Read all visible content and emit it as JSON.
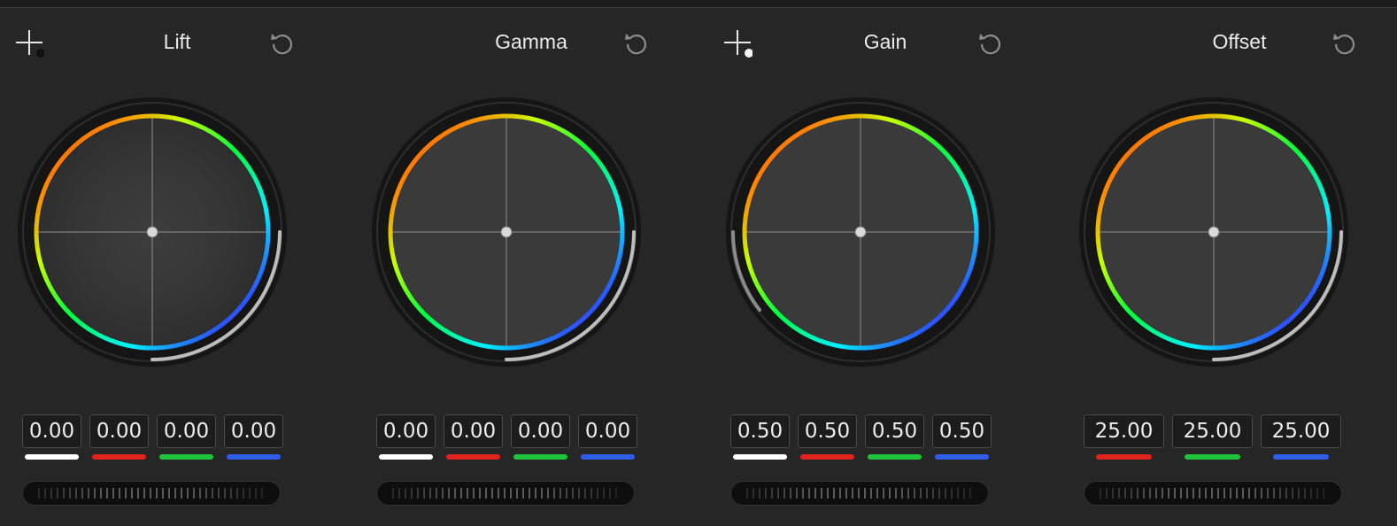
{
  "colors": {
    "background": "#262626",
    "master_bar": "#ffffff",
    "red_bar": "#e0231c",
    "green_bar": "#1fc43a",
    "blue_bar": "#2f5ee6"
  },
  "wheels": [
    {
      "title": "Lift",
      "has_picker": true,
      "picker_dot": "dark",
      "ring_arc": "bottom-right",
      "values": [
        {
          "channel": "Y",
          "value": "0.00",
          "color": "#ffffff"
        },
        {
          "channel": "R",
          "value": "0.00",
          "color": "#e0231c"
        },
        {
          "channel": "G",
          "value": "0.00",
          "color": "#1fc43a"
        },
        {
          "channel": "B",
          "value": "0.00",
          "color": "#2f5ee6"
        }
      ]
    },
    {
      "title": "Gamma",
      "has_picker": false,
      "ring_arc": "bottom-right",
      "values": [
        {
          "channel": "Y",
          "value": "0.00",
          "color": "#ffffff"
        },
        {
          "channel": "R",
          "value": "0.00",
          "color": "#e0231c"
        },
        {
          "channel": "G",
          "value": "0.00",
          "color": "#1fc43a"
        },
        {
          "channel": "B",
          "value": "0.00",
          "color": "#2f5ee6"
        }
      ]
    },
    {
      "title": "Gain",
      "has_picker": true,
      "picker_dot": "light",
      "ring_arc": "left",
      "values": [
        {
          "channel": "Y",
          "value": "0.50",
          "color": "#ffffff"
        },
        {
          "channel": "R",
          "value": "0.50",
          "color": "#e0231c"
        },
        {
          "channel": "G",
          "value": "0.50",
          "color": "#1fc43a"
        },
        {
          "channel": "B",
          "value": "0.50",
          "color": "#2f5ee6"
        }
      ]
    },
    {
      "title": "Offset",
      "has_picker": false,
      "ring_arc": "bottom-right",
      "values": [
        {
          "channel": "R",
          "value": "25.00",
          "color": "#e0231c"
        },
        {
          "channel": "G",
          "value": "25.00",
          "color": "#1fc43a"
        },
        {
          "channel": "B",
          "value": "25.00",
          "color": "#2f5ee6"
        }
      ]
    }
  ]
}
